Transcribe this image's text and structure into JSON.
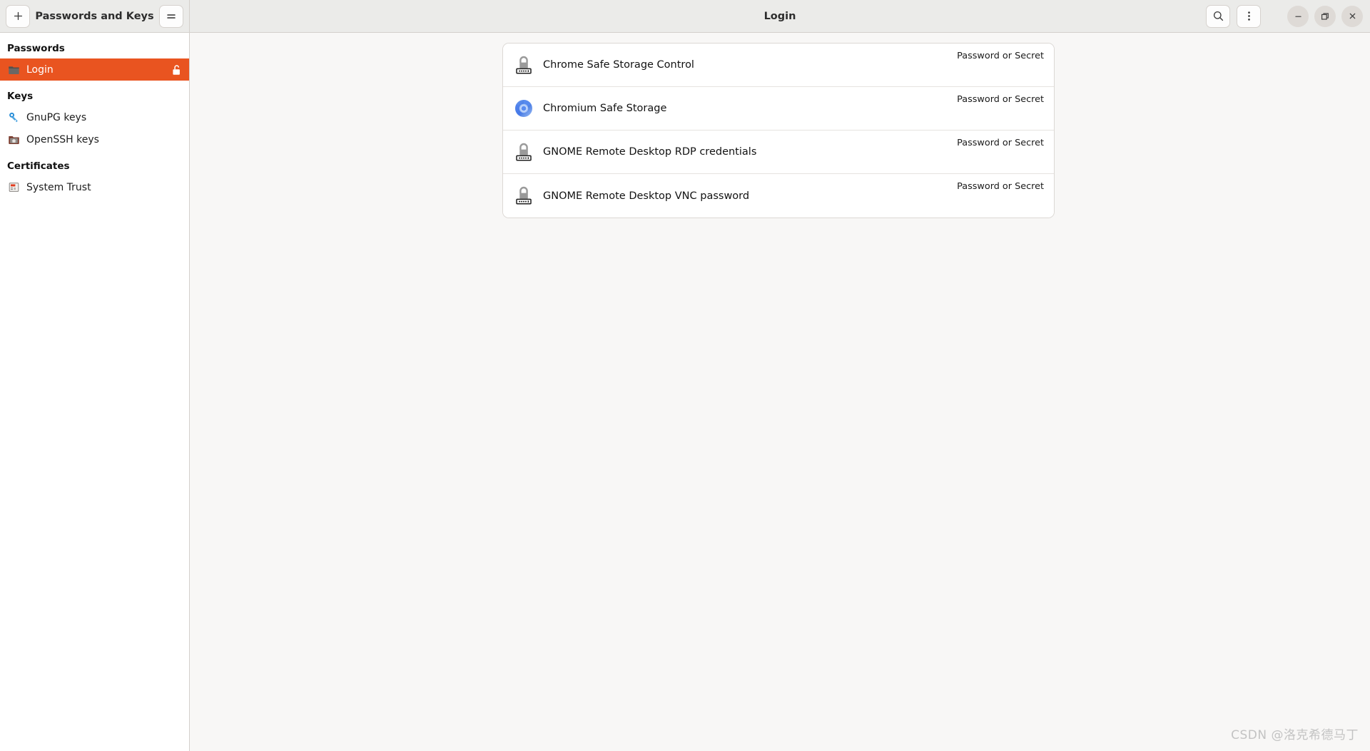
{
  "window": {
    "app_title": "Passwords and Keys",
    "title": "Login",
    "add_button_label": "+",
    "menu_button_label": "≡",
    "search_icon": "search-icon",
    "more_icon": "more-options-icon",
    "minimize_label": "—",
    "maximize_label": "❐",
    "close_label": "✕"
  },
  "sidebar": {
    "groups": [
      {
        "title": "Passwords",
        "items": [
          {
            "label": "Login",
            "icon": "folder-icon",
            "selected": true,
            "trailing_icon": "unlocked-padlock-icon"
          }
        ]
      },
      {
        "title": "Keys",
        "items": [
          {
            "label": "GnuPG keys",
            "icon": "gnupg-key-icon",
            "selected": false,
            "trailing_icon": ""
          },
          {
            "label": "OpenSSH keys",
            "icon": "openssh-folder-icon",
            "selected": false,
            "trailing_icon": ""
          }
        ]
      },
      {
        "title": "Certificates",
        "items": [
          {
            "label": "System Trust",
            "icon": "certificate-icon",
            "selected": false,
            "trailing_icon": ""
          }
        ]
      }
    ]
  },
  "main": {
    "rows": [
      {
        "title": "Chrome Safe Storage Control",
        "meta": "Password or Secret",
        "icon": "password-lock-icon"
      },
      {
        "title": "Chromium Safe Storage",
        "meta": "Password or Secret",
        "icon": "chromium-icon"
      },
      {
        "title": "GNOME Remote Desktop RDP credentials",
        "meta": "Password or Secret",
        "icon": "password-lock-icon"
      },
      {
        "title": "GNOME Remote Desktop VNC password",
        "meta": "Password or Secret",
        "icon": "password-lock-icon"
      }
    ]
  },
  "watermark": {
    "text": "CSDN @洛克希德马丁"
  },
  "colors": {
    "accent": "#e95420",
    "headerbar": "#ebebe9",
    "content_bg": "#f8f7f6",
    "card_bg": "#ffffff",
    "border": "#d4d0cc"
  }
}
